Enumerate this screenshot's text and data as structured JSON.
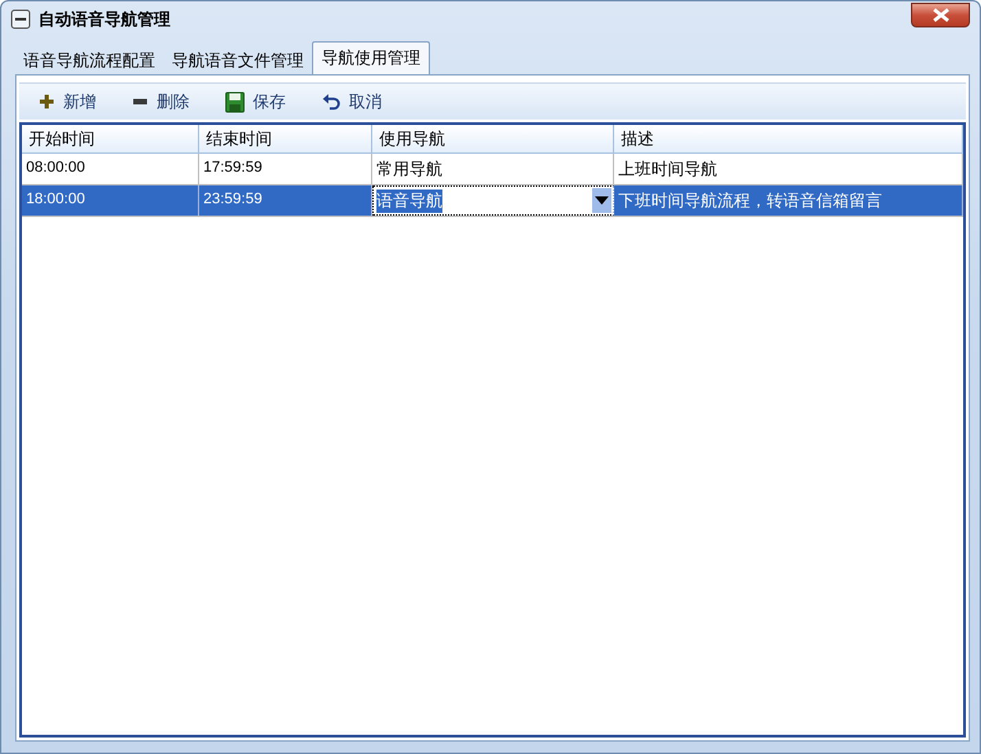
{
  "window": {
    "title": "自动语音导航管理"
  },
  "tabs": [
    {
      "label": "语音导航流程配置",
      "selected": false
    },
    {
      "label": "导航语音文件管理",
      "selected": false
    },
    {
      "label": "导航使用管理",
      "selected": true
    }
  ],
  "toolbar": [
    {
      "kind": "add",
      "label": "新增"
    },
    {
      "kind": "delete",
      "label": "删除"
    },
    {
      "kind": "save",
      "label": "保存"
    },
    {
      "kind": "cancel",
      "label": "取消"
    }
  ],
  "table": {
    "columns": [
      "开始时间",
      "结束时间",
      "使用导航",
      "描述"
    ],
    "rows": [
      {
        "selected": false,
        "editing": false,
        "cells": [
          "08:00:00",
          "17:59:59",
          "常用导航",
          "上班时间导航"
        ]
      },
      {
        "selected": true,
        "editing": true,
        "cells": [
          "18:00:00",
          "23:59:59",
          "语音导航",
          "下班时间导航流程，转语音信箱留言"
        ]
      }
    ]
  }
}
